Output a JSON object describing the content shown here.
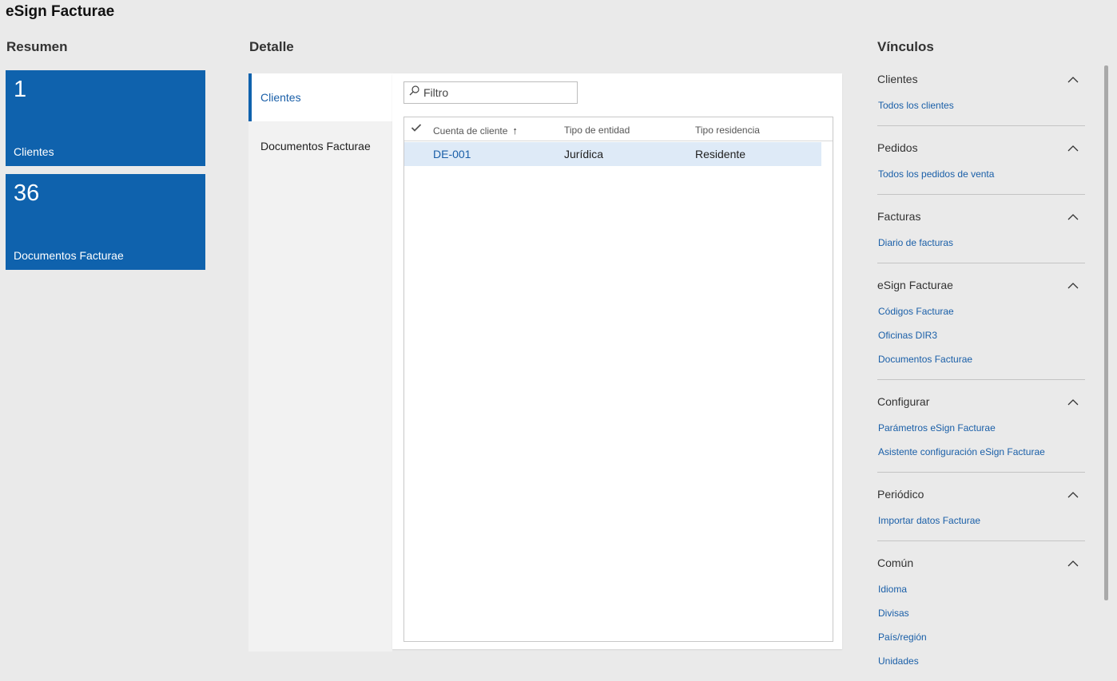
{
  "app_title": "eSign Facturae",
  "sections": {
    "resumen": "Resumen",
    "detalle": "Detalle",
    "vinculos": "Vínculos"
  },
  "tiles": [
    {
      "count": "1",
      "label": "Clientes"
    },
    {
      "count": "36",
      "label": "Documentos Facturae"
    }
  ],
  "tabs": [
    {
      "label": "Clientes",
      "active": true
    },
    {
      "label": "Documentos Facturae",
      "active": false
    }
  ],
  "filter": {
    "placeholder": "Filtro",
    "value": ""
  },
  "grid": {
    "columns": [
      "Cuenta de cliente",
      "Tipo de entidad",
      "Tipo residencia"
    ],
    "sort_indicator": "↑",
    "rows": [
      {
        "account": "DE-001",
        "entity_type": "Jurídica",
        "residence_type": "Residente",
        "selected": true
      }
    ]
  },
  "links": [
    {
      "title": "Clientes",
      "items": [
        "Todos los clientes"
      ]
    },
    {
      "title": "Pedidos",
      "items": [
        "Todos los pedidos de venta"
      ]
    },
    {
      "title": "Facturas",
      "items": [
        "Diario de facturas"
      ]
    },
    {
      "title": "eSign Facturae",
      "items": [
        "Códigos Facturae",
        "Oficinas DIR3",
        "Documentos Facturae"
      ]
    },
    {
      "title": "Configurar",
      "items": [
        "Parámetros eSign Facturae",
        "Asistente configuración eSign Facturae"
      ]
    },
    {
      "title": "Periódico",
      "items": [
        "Importar datos Facturae"
      ]
    },
    {
      "title": "Común",
      "items": [
        "Idioma",
        "Divisas",
        "País/región",
        "Unidades"
      ]
    }
  ],
  "colors": {
    "accent": "#0f62ad",
    "link": "#1a5fa8",
    "selected_row": "#deeaf7",
    "background": "#eaeaea"
  },
  "icons": {
    "filter": "search-icon",
    "check": "checkmark-icon",
    "collapse": "chevron-up-icon"
  }
}
